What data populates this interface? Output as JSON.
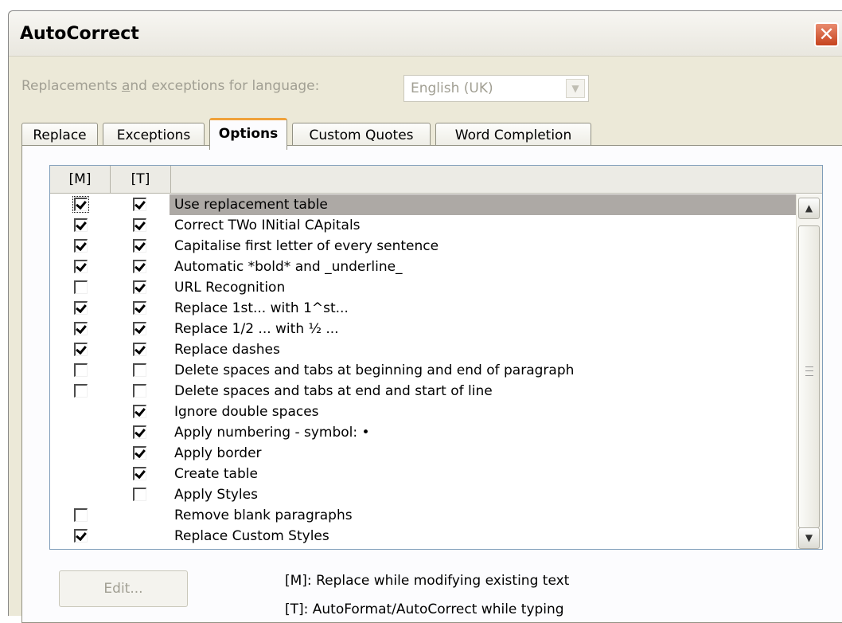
{
  "window": {
    "title": "AutoCorrect",
    "close_symbol": "✕"
  },
  "language": {
    "label_pre": "Replacements ",
    "label_accel": "a",
    "label_post": "nd exceptions for language:",
    "value": "English (UK)"
  },
  "tabs": [
    {
      "label": "Replace",
      "active": false
    },
    {
      "label": "Exceptions",
      "active": false
    },
    {
      "label": "Options",
      "active": true
    },
    {
      "label": "Custom Quotes",
      "active": false
    },
    {
      "label": "Word Completion",
      "active": false
    }
  ],
  "options_table": {
    "col_m": "[M]",
    "col_t": "[T]",
    "rows": [
      {
        "label": "Use replacement table",
        "m": true,
        "t": true
      },
      {
        "label": "Correct TWo INitial CApitals",
        "m": true,
        "t": true
      },
      {
        "label": "Capitalise first letter of every sentence",
        "m": true,
        "t": true
      },
      {
        "label": "Automatic *bold* and _underline_",
        "m": true,
        "t": true
      },
      {
        "label": "URL Recognition",
        "m": false,
        "t": true
      },
      {
        "label": "Replace 1st... with 1^st...",
        "m": true,
        "t": true
      },
      {
        "label": "Replace 1/2 ... with ½ ...",
        "m": true,
        "t": true
      },
      {
        "label": "Replace dashes",
        "m": true,
        "t": true
      },
      {
        "label": "Delete spaces and tabs at beginning and end of paragraph",
        "m": false,
        "t": false
      },
      {
        "label": "Delete spaces and tabs at end and start of line",
        "m": false,
        "t": false
      },
      {
        "label": "Ignore double spaces",
        "m": null,
        "t": true
      },
      {
        "label": "Apply numbering - symbol: •",
        "m": null,
        "t": true
      },
      {
        "label": "Apply border",
        "m": null,
        "t": true
      },
      {
        "label": "Create table",
        "m": null,
        "t": true
      },
      {
        "label": "Apply Styles",
        "m": null,
        "t": false
      },
      {
        "label": "Remove blank paragraphs",
        "m": false,
        "t": null
      },
      {
        "label": "Replace Custom Styles",
        "m": true,
        "t": null
      }
    ]
  },
  "scrollbar": {
    "up_symbol": "▲",
    "down_symbol": "▼"
  },
  "edit_button": {
    "label": "Edit..."
  },
  "legend": {
    "m": "[M]: Replace while modifying existing text",
    "t": "[T]: AutoFormat/AutoCorrect while typing"
  }
}
